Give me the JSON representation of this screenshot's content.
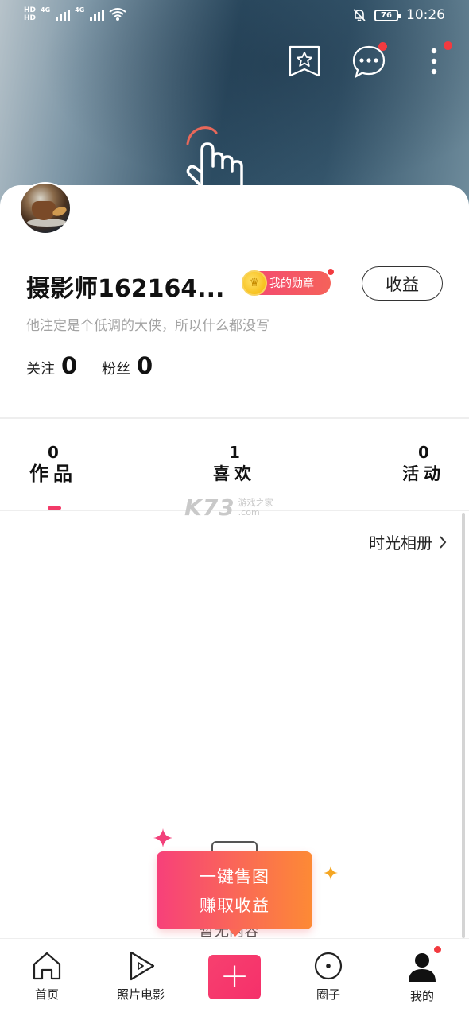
{
  "status_bar": {
    "sim1": "HD",
    "sim2": "HD",
    "net1": "4G",
    "net2": "4G",
    "battery": "76",
    "time": "10:26"
  },
  "header_icons": [
    "bookmark-star-icon",
    "message-more-icon",
    "more-vertical-icon"
  ],
  "profile": {
    "name": "摄影师162164...",
    "badge_label": "我的勋章",
    "earnings_button": "收益",
    "bio": "他注定是个低调的大侠，所以什么都没写",
    "following_label": "关注",
    "following_count": "0",
    "followers_label": "粉丝",
    "followers_count": "0"
  },
  "tabs": [
    {
      "label": "作品",
      "count": "0",
      "active": true
    },
    {
      "label": "喜欢",
      "count": "1",
      "active": false
    },
    {
      "label": "活动",
      "count": "0",
      "active": false
    }
  ],
  "watermark": {
    "big": "K73",
    "small_top": "游戏之家",
    "small_bottom": ".com"
  },
  "album_link": "时光相册",
  "empty_state": {
    "text": "暂无内容"
  },
  "promo": {
    "line1": "一键售图",
    "line2": "赚取收益"
  },
  "nav": [
    {
      "label": "首页",
      "icon": "home-icon"
    },
    {
      "label": "照片电影",
      "icon": "play-icon"
    },
    {
      "label": "",
      "icon": "plus-icon"
    },
    {
      "label": "圈子",
      "icon": "circle-icon"
    },
    {
      "label": "我的",
      "icon": "person-icon"
    }
  ],
  "colors": {
    "accent": "#f23a68",
    "badge_gradient_start": "#f44773",
    "promo_gradient_end": "#fd8a35",
    "notification_dot": "#f23a3f"
  }
}
